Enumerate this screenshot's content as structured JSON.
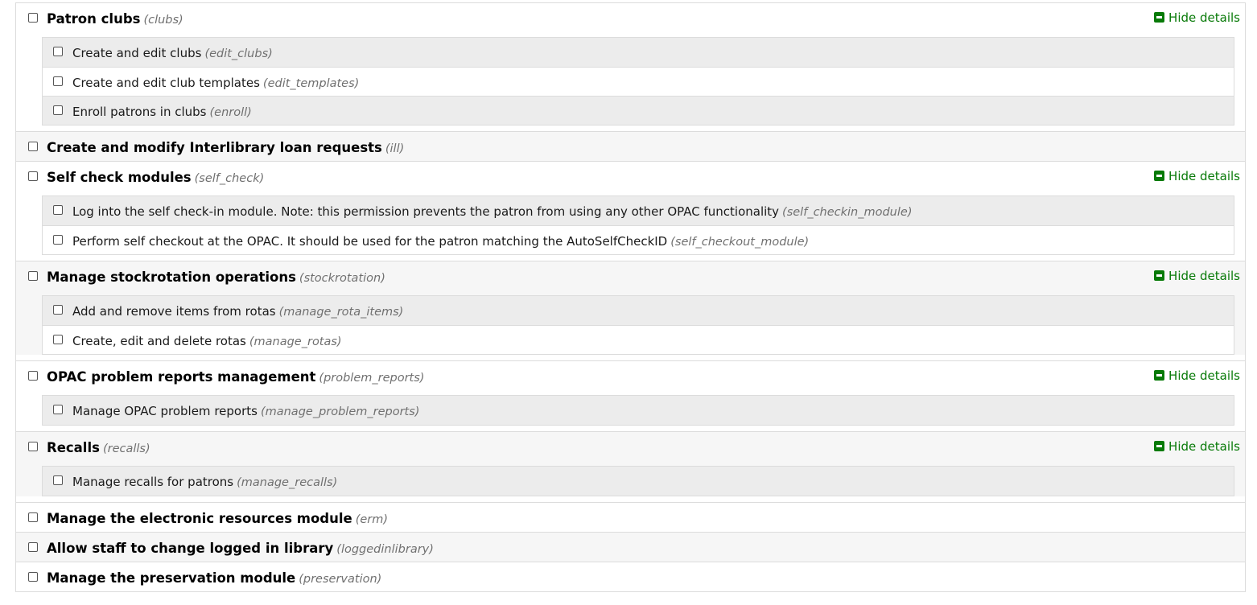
{
  "toggle_label": "Hide details",
  "colors": {
    "accent_green": "#087a08",
    "border": "#dcdcdc",
    "code_gray": "#707070"
  },
  "groups": [
    {
      "name": "Patron clubs",
      "code": "(clubs)",
      "has_details": true,
      "subpermissions": [
        {
          "name": "Create and edit clubs",
          "code": "(edit_clubs)"
        },
        {
          "name": "Create and edit club templates",
          "code": "(edit_templates)"
        },
        {
          "name": "Enroll patrons in clubs",
          "code": "(enroll)"
        }
      ]
    },
    {
      "name": "Create and modify Interlibrary loan requests",
      "code": "(ill)",
      "has_details": false,
      "subpermissions": []
    },
    {
      "name": "Self check modules",
      "code": "(self_check)",
      "has_details": true,
      "subpermissions": [
        {
          "name": "Log into the self check-in module. Note: this permission prevents the patron from using any other OPAC functionality",
          "code": "(self_checkin_module)"
        },
        {
          "name": "Perform self checkout at the OPAC. It should be used for the patron matching the AutoSelfCheckID",
          "code": "(self_checkout_module)"
        }
      ]
    },
    {
      "name": "Manage stockrotation operations",
      "code": "(stockrotation)",
      "has_details": true,
      "subpermissions": [
        {
          "name": "Add and remove items from rotas",
          "code": "(manage_rota_items)"
        },
        {
          "name": "Create, edit and delete rotas",
          "code": "(manage_rotas)"
        }
      ]
    },
    {
      "name": "OPAC problem reports management",
      "code": "(problem_reports)",
      "has_details": true,
      "subpermissions": [
        {
          "name": "Manage OPAC problem reports",
          "code": "(manage_problem_reports)"
        }
      ]
    },
    {
      "name": "Recalls",
      "code": "(recalls)",
      "has_details": true,
      "subpermissions": [
        {
          "name": "Manage recalls for patrons",
          "code": "(manage_recalls)"
        }
      ]
    },
    {
      "name": "Manage the electronic resources module",
      "code": "(erm)",
      "has_details": false,
      "subpermissions": []
    },
    {
      "name": "Allow staff to change logged in library",
      "code": "(loggedinlibrary)",
      "has_details": false,
      "subpermissions": []
    },
    {
      "name": "Manage the preservation module",
      "code": "(preservation)",
      "has_details": false,
      "subpermissions": []
    }
  ]
}
